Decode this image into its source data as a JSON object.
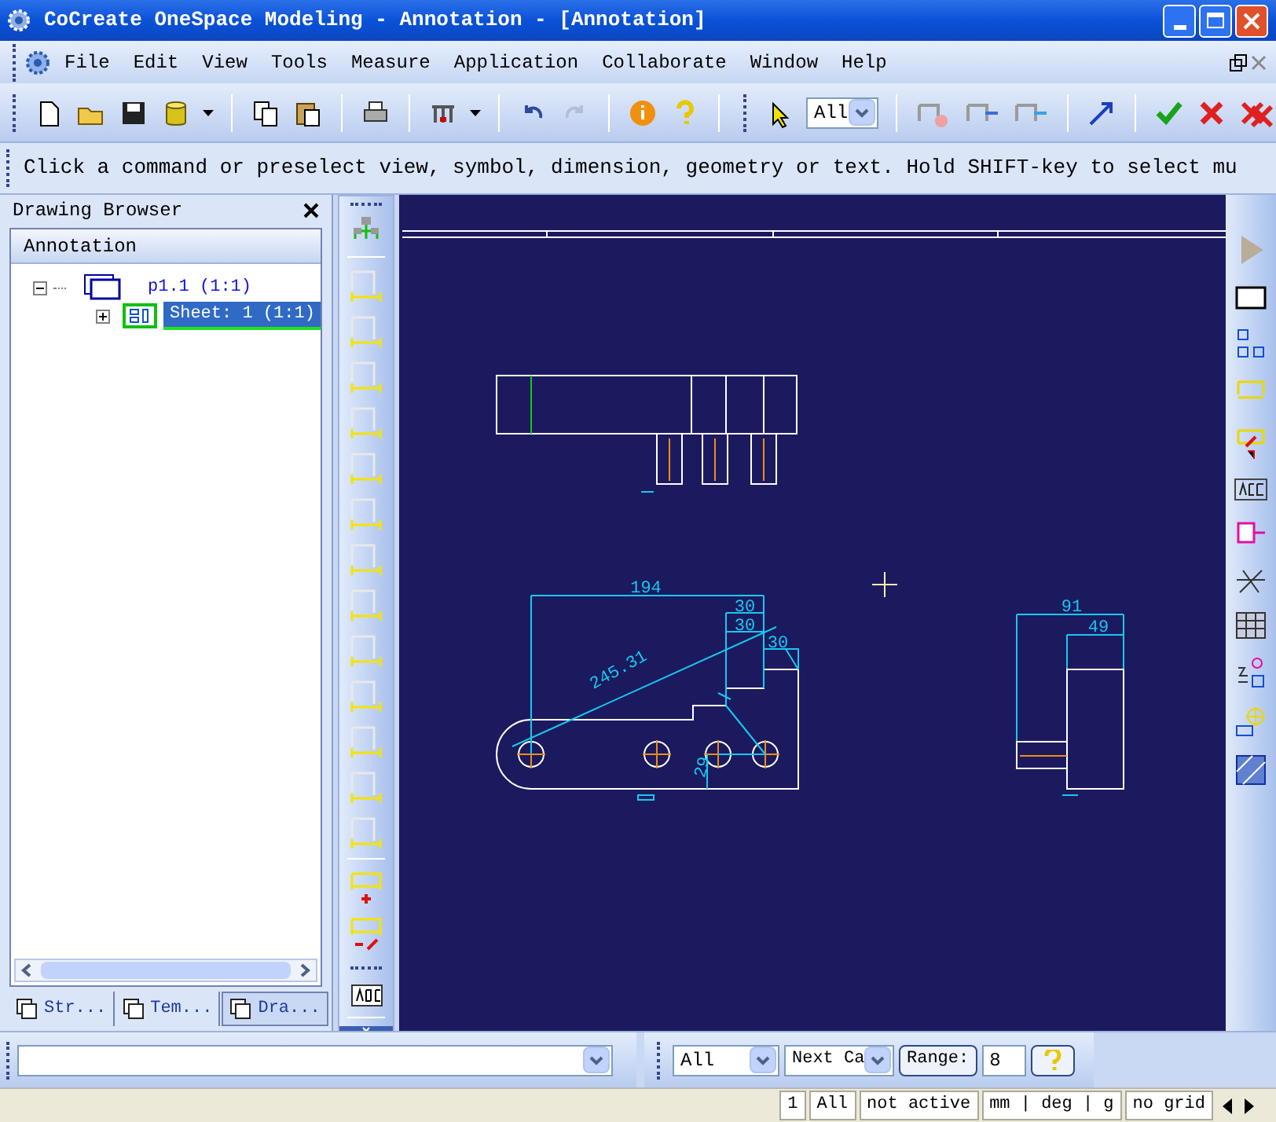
{
  "window": {
    "title": "CoCreate OneSpace Modeling - Annotation - [Annotation]"
  },
  "menu": [
    "File",
    "Edit",
    "View",
    "Tools",
    "Measure",
    "Application",
    "Collaborate",
    "Window",
    "Help"
  ],
  "toolbar": {
    "filter": "All"
  },
  "prompt": "Click a command or preselect view, symbol, dimension, geometry or text. Hold SHIFT-key to select mu",
  "browser": {
    "title": "Drawing Browser",
    "header": "Annotation",
    "tree": [
      {
        "label": "p1.1 (1:1)",
        "expanded": true,
        "selected": false,
        "children": [
          {
            "label": "Sheet: 1 (1:1)",
            "expanded": false,
            "selected": true
          }
        ]
      }
    ],
    "tabs": [
      {
        "label": "Str...",
        "selected": false
      },
      {
        "label": "Tem...",
        "selected": false
      },
      {
        "label": "Dra...",
        "selected": true
      }
    ]
  },
  "canvas": {
    "dimension_labels": [
      "194",
      "30",
      "30",
      "30",
      "245.31",
      "29",
      "91",
      "49"
    ]
  },
  "command_bar": {
    "filter": "All",
    "category": "Next Ca",
    "range_label": "Range:",
    "range_value": "8"
  },
  "status_bar": [
    "1",
    "All",
    "not active",
    "mm | deg | g",
    "no grid"
  ]
}
